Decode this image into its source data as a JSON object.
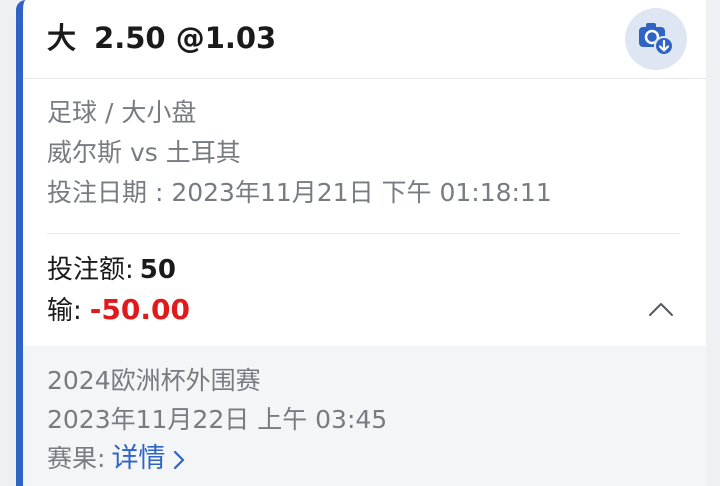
{
  "bet": {
    "selection": "大",
    "line": "2.50",
    "odds": "@1.03"
  },
  "icons": {
    "download_snapshot": "camera-download-icon",
    "collapse": "chevron-up-icon",
    "details_arrow": "chevron-right-icon"
  },
  "info": {
    "sport_market": "足球 / 大小盘",
    "match": "威尔斯 vs 土耳其",
    "bet_date": "投注日期 : 2023年11月21日 下午 01:18:11"
  },
  "stake": {
    "label": "投注额:",
    "value": "50"
  },
  "result": {
    "label": "输:",
    "value": "-50.00"
  },
  "event": {
    "league": "2024欧洲杯外围赛",
    "time": "2023年11月22日 上午 03:45",
    "score_label": "赛果:",
    "details_link": "详情"
  },
  "colors": {
    "accent": "#2f63c4",
    "loss": "#e01a1a",
    "muted_text": "#777b82",
    "panel_bg": "#f4f5f7"
  }
}
